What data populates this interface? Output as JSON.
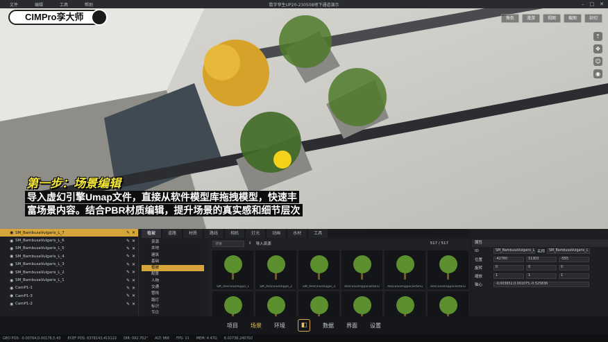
{
  "menu": {
    "items": [
      "文件",
      "编辑",
      "工具",
      "帮助"
    ],
    "title": "数字孪生UP20-230508地下通道演示"
  },
  "logo": "CIMPro孪大师",
  "viewport": {
    "buttons": [
      "角色",
      "漫游",
      "视图",
      "截图",
      "剖切"
    ]
  },
  "overlay": {
    "step_title": "第一步：场景编辑",
    "step_text": "导入虚幻引擎Umap文件，直接从软件模型库拖拽模型，快速丰富场景内容。结合PBR材质编辑，提升场景的真实感和细节层次"
  },
  "outliner": {
    "rows": [
      "SM_BambusaVulgaris_L_7",
      "SM_BambusaVulgaris_L_6",
      "SM_BambusaVulgaris_L_5",
      "SM_BambusaVulgaris_L_4",
      "SM_BambusaVulgaris_L_3",
      "SM_BambusaVulgaris_L_2",
      "SM_BambusaVulgaris_L_1",
      "CamP1-1",
      "CamP1-3",
      "CamP1-2"
    ]
  },
  "tabs": [
    "植被",
    "道路",
    "材质",
    "路线",
    "相机",
    "灯光",
    "动画",
    "水材",
    "工具"
  ],
  "tree": [
    "资源",
    "本地",
    "建筑",
    "基础",
    "植被",
    "配景",
    "人物",
    "交通",
    "管线",
    "路灯",
    "标识",
    "节日"
  ],
  "library": {
    "search_placeholder": "搜索",
    "import_label": "导入资源",
    "count": "517 / 517",
    "items": [
      "SM_AesculusHippo_1",
      "SM_AesculusHippo_2",
      "SM_AesculusHippo_3",
      "AesculusHippocastanu",
      "AesculusHippocastanu",
      "AesculusHippocastanu",
      "",
      "",
      "",
      "",
      "",
      ""
    ]
  },
  "props": {
    "header": "属性",
    "name_label": "名称",
    "name_value": "SM_BambusaVulgaris_L",
    "id_label": "ID",
    "pos_label": "位置",
    "pos": [
      "-42760",
      "11303",
      "-555"
    ],
    "rot_label": "旋转",
    "rot": [
      "0",
      "0",
      "0"
    ],
    "scale_label": "缩放",
    "scale": [
      "1",
      "1",
      "1"
    ],
    "pivot_label": "轴心",
    "pivot_value": "-0.003652,0.001075,-0.525836"
  },
  "nav": [
    "项目",
    "场景",
    "环境",
    "数据",
    "界面",
    "设置"
  ],
  "status": [
    "GEO POS: -0.00764,0.00176,5.43",
    "ECEF POS: 6378143,415122",
    "DIR: 092.702°",
    "ALT: 966",
    "FPS: 11",
    "MEM: 4.47G",
    "6.02736,240702"
  ]
}
